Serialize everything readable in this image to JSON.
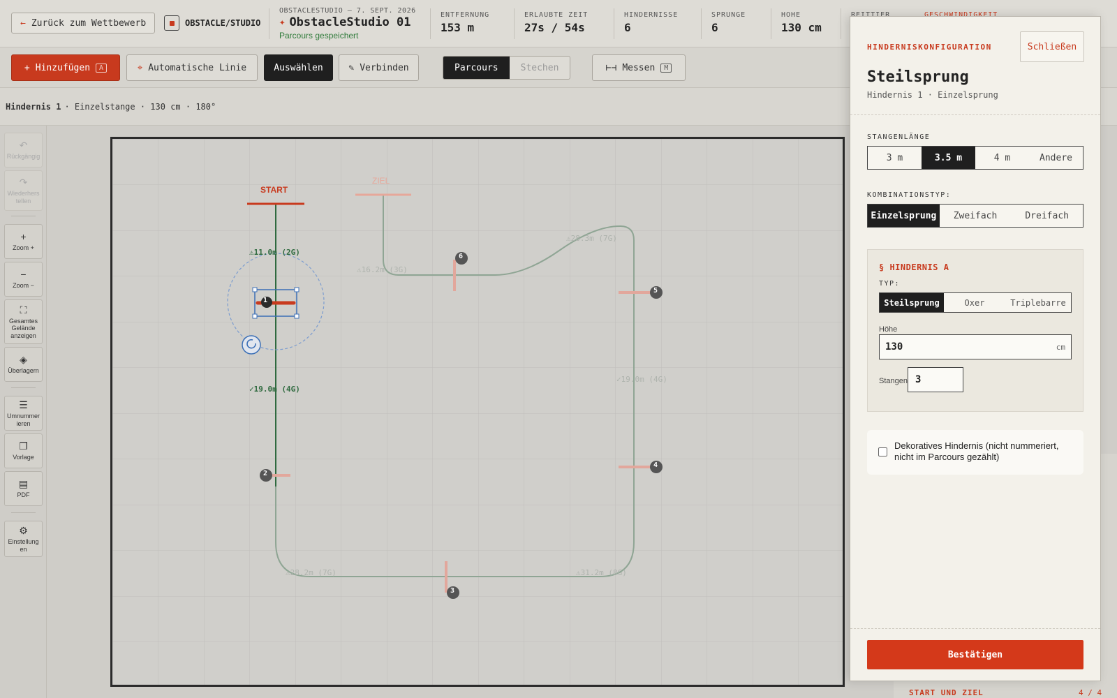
{
  "header": {
    "back_label": "Zurück zum Wettbewerb",
    "brand": "OBSTACLE/STUDIO",
    "date": "OBSTACLESTUDIO — 7. SEPT. 2026",
    "project_name": "ObstacleStudio 01",
    "saved_status": "Parcours gespeichert",
    "stats": [
      {
        "label": "ENTFERNUNG",
        "value": "153 m"
      },
      {
        "label": "ERLAUBTE ZEIT",
        "value": "27s / 54s"
      },
      {
        "label": "HINDERNISSE",
        "value": "6"
      },
      {
        "label": "SPRUNGE",
        "value": "6"
      },
      {
        "label": "HOHE",
        "value": "130 cm"
      },
      {
        "label": "REITTIER",
        "value": ""
      },
      {
        "label": "GESCHWINDIGKEIT",
        "value": ""
      }
    ]
  },
  "toolbar": {
    "add_label": "Hinzufügen",
    "add_key": "A",
    "autoline_label": "Automatische Linie",
    "select_label": "Auswählen",
    "connect_label": "Verbinden",
    "mode_tabs": [
      "Parcours",
      "Stechen"
    ],
    "measure_label": "Messen",
    "measure_key": "M"
  },
  "info": {
    "title": "Hindernis 1",
    "detail": "· Einzelstange · 130 cm · 180°"
  },
  "left_tools": [
    {
      "label": "Rückgängig",
      "icon": "undo-icon",
      "disabled": true
    },
    {
      "label": "Wiederherstellen",
      "icon": "redo-icon",
      "disabled": true
    },
    {
      "label": "Zoom +",
      "icon": "plus-icon"
    },
    {
      "label": "Zoom −",
      "icon": "minus-icon"
    },
    {
      "label": "Gesamtes Gelände anzeigen",
      "icon": "fit-screen-icon"
    },
    {
      "label": "Überlagern",
      "icon": "layers-icon"
    },
    {
      "label": "Umnummerieren",
      "icon": "list-numbers-icon"
    },
    {
      "label": "Vorlage",
      "icon": "copy-icon"
    },
    {
      "label": "PDF",
      "icon": "pdf-icon"
    },
    {
      "label": "Einstellungen",
      "icon": "gear-icon"
    }
  ],
  "canvas": {
    "start_label": "START",
    "finish_label": "ZIEL",
    "obstacle_numbers": [
      "1",
      "2",
      "3",
      "4",
      "5",
      "6"
    ],
    "distances": [
      "⚠11.0m (2G)",
      "✓19.0m (4G)",
      "⚠28.2m (7G)",
      "⚠31.2m (8G)",
      "✓19.0m (4G)",
      "⚠28.3m (7G)",
      "⚠16.2m (3G)"
    ]
  },
  "peek": {
    "title": "START UND ZIEL",
    "count": "4 / 4"
  },
  "modal": {
    "kicker": "HINDERNISKONFIGURATION",
    "close_label": "Schließen",
    "title": "Steilsprung",
    "subtitle": "Hindernis 1 · Einzelsprung",
    "pole_length_label": "STANGENLÄNGE",
    "pole_lengths": [
      "3 m",
      "3.5 m",
      "4 m",
      "Andere"
    ],
    "pole_length_selected": "3.5 m",
    "combo_label": "KOMBINATIONSTYP:",
    "combo_types": [
      "Einzelsprung",
      "Zweifach",
      "Dreifach"
    ],
    "combo_selected": "Einzelsprung",
    "obstacle_a_title": "§ HINDERNIS A",
    "type_label": "TYP:",
    "types": [
      "Steilsprung",
      "Oxer",
      "Triplebarre"
    ],
    "type_selected": "Steilsprung",
    "height_label": "Höhe",
    "height_value": "130",
    "height_unit": "cm",
    "poles_label": "Stangen",
    "poles_value": "3",
    "decorative_label": "Dekoratives Hindernis (nicht nummeriert, nicht im Parcours gezählt)",
    "decorative_checked": false,
    "confirm_label": "Bestätigen"
  },
  "colors": {
    "accent": "#c83a1e",
    "course_line": "#2f6a3f",
    "dark": "#1f1f1f"
  }
}
